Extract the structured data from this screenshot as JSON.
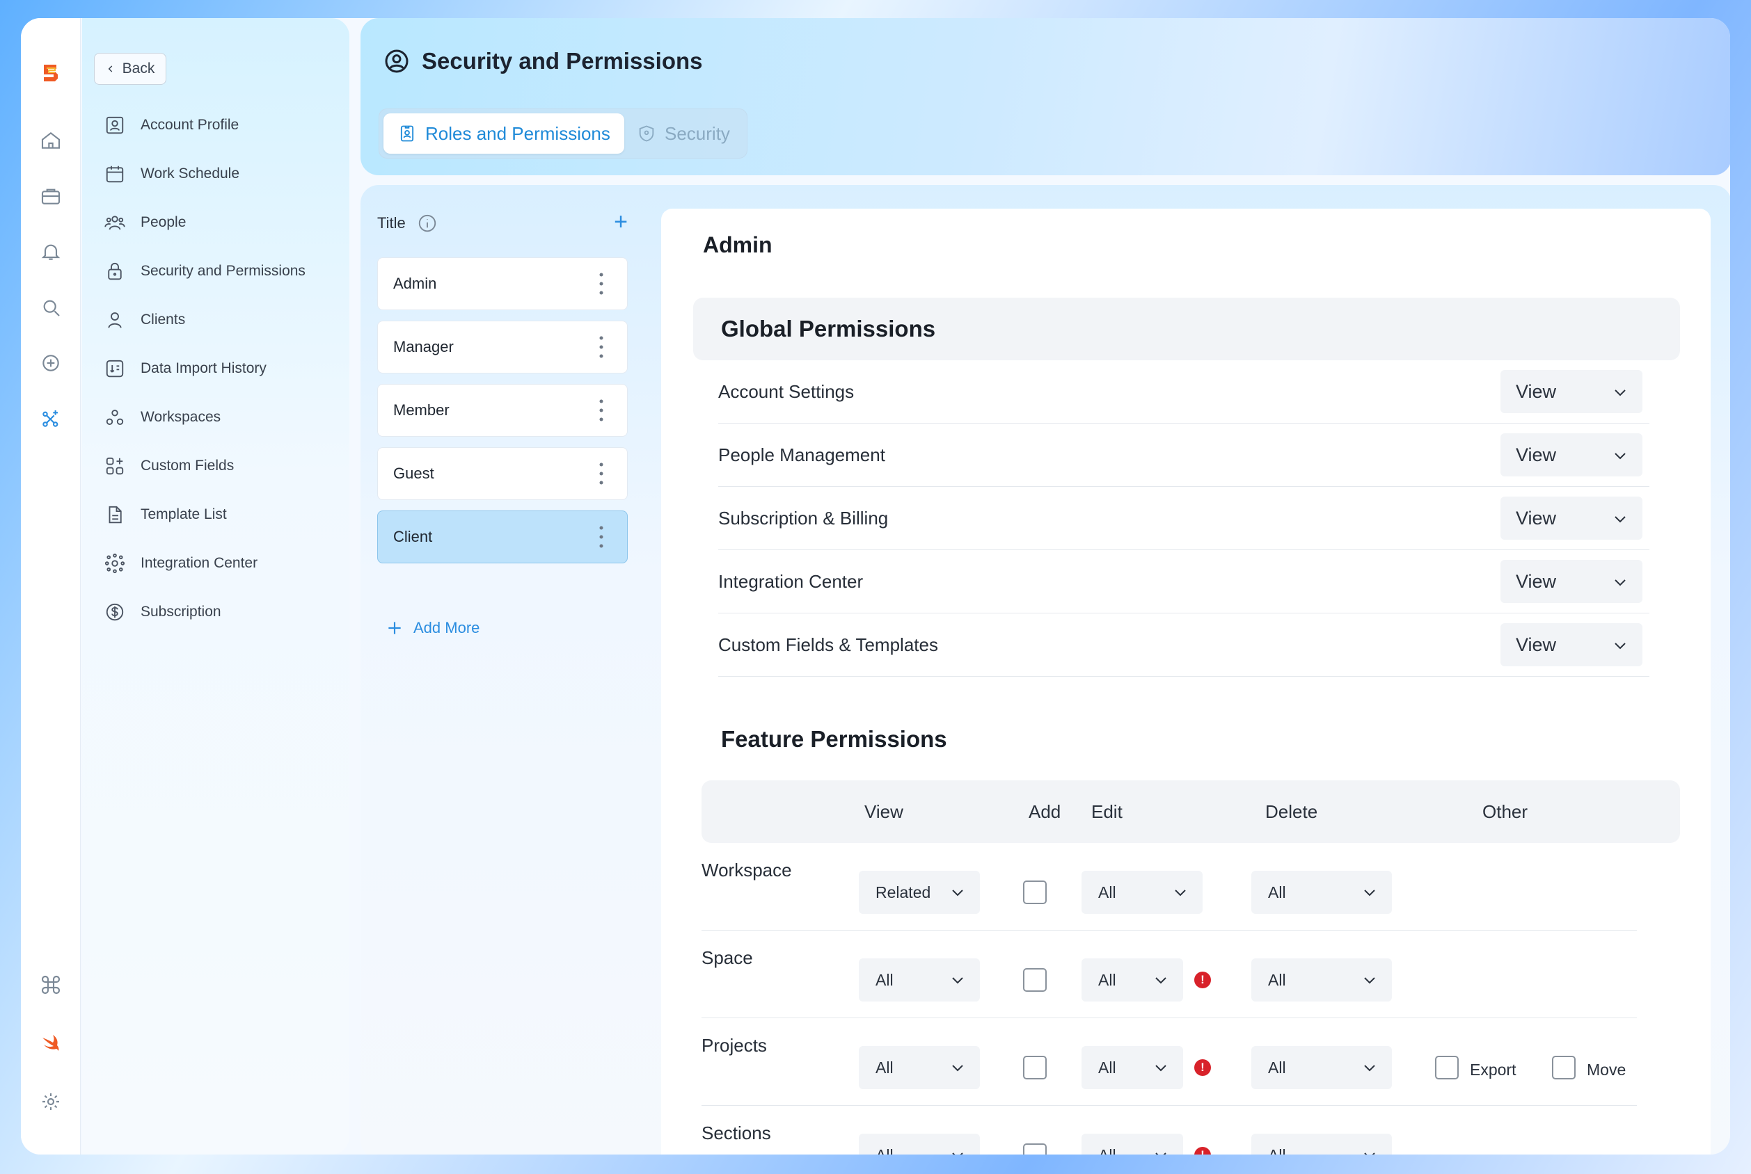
{
  "header": {
    "title": "Security and Permissions"
  },
  "tabs": [
    {
      "label": "Roles and Permissions",
      "active": true
    },
    {
      "label": "Security",
      "active": false
    }
  ],
  "sidebar": {
    "back_label": "Back",
    "items": [
      {
        "label": "Account Profile",
        "icon": "id-card-icon"
      },
      {
        "label": "Work Schedule",
        "icon": "calendar-icon"
      },
      {
        "label": "People",
        "icon": "people-icon"
      },
      {
        "label": "Security and Permissions",
        "icon": "lock-icon"
      },
      {
        "label": "Clients",
        "icon": "user-icon"
      },
      {
        "label": "Data Import History",
        "icon": "import-icon"
      },
      {
        "label": "Workspaces",
        "icon": "workspaces-icon"
      },
      {
        "label": "Custom Fields",
        "icon": "custom-fields-icon"
      },
      {
        "label": "Template List",
        "icon": "document-icon"
      },
      {
        "label": "Integration Center",
        "icon": "integration-icon"
      },
      {
        "label": "Subscription",
        "icon": "dollar-icon"
      }
    ]
  },
  "roles": {
    "heading": "Title",
    "items": [
      "Admin",
      "Manager",
      "Member",
      "Guest",
      "Client"
    ],
    "selected": "Client",
    "add_more": "Add More"
  },
  "detail": {
    "role_title": "Admin",
    "global_title": "Global Permissions",
    "global": [
      {
        "label": "Account Settings",
        "value": "View"
      },
      {
        "label": "People Management",
        "value": "View"
      },
      {
        "label": "Subscription & Billing",
        "value": "View"
      },
      {
        "label": "Integration Center",
        "value": "View"
      },
      {
        "label": "Custom Fields & Templates",
        "value": "View"
      }
    ],
    "feature_title": "Feature Permissions",
    "feature_headers": {
      "view": "View",
      "add": "Add",
      "edit": "Edit",
      "delete": "Delete",
      "other": "Other"
    },
    "feature": [
      {
        "label": "Workspace",
        "view": "Related",
        "edit": "All",
        "delete": "All",
        "warning": false,
        "other": []
      },
      {
        "label": "Space",
        "view": "All",
        "edit": "All",
        "delete": "All",
        "warning": true,
        "other": []
      },
      {
        "label": "Projects",
        "view": "All",
        "edit": "All",
        "delete": "All",
        "warning": true,
        "other": [
          "Export",
          "Move"
        ]
      },
      {
        "label": "Sections",
        "view": "All",
        "edit": "All",
        "delete": "All",
        "warning": true,
        "other": []
      }
    ]
  },
  "colors": {
    "accent": "#2b8de0",
    "selected_role": "#bde2fb",
    "warning": "#d8222a"
  }
}
